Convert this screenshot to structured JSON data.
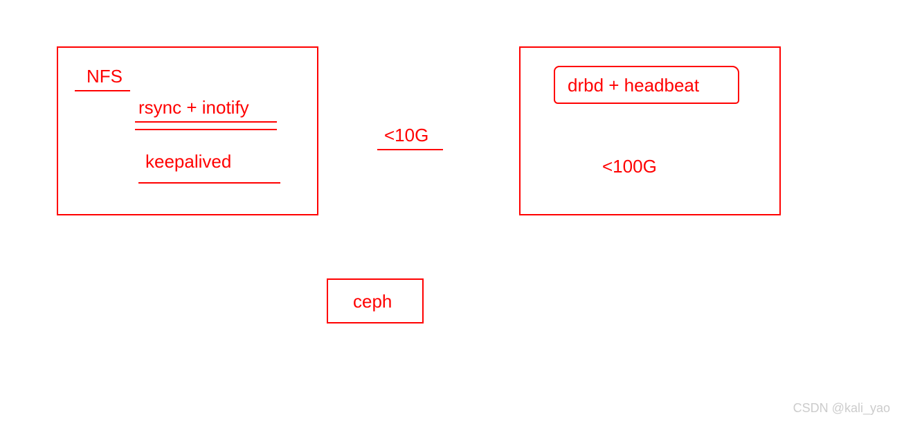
{
  "left_box": {
    "nfs": "NFS",
    "rsync": "rsync + inotify",
    "keepalived": "keepalived"
  },
  "middle": {
    "size": "<10G"
  },
  "right_box": {
    "drbd": "drbd + headbeat",
    "size": "<100G"
  },
  "bottom": {
    "ceph": "ceph"
  },
  "watermark": "CSDN @kali_yao"
}
